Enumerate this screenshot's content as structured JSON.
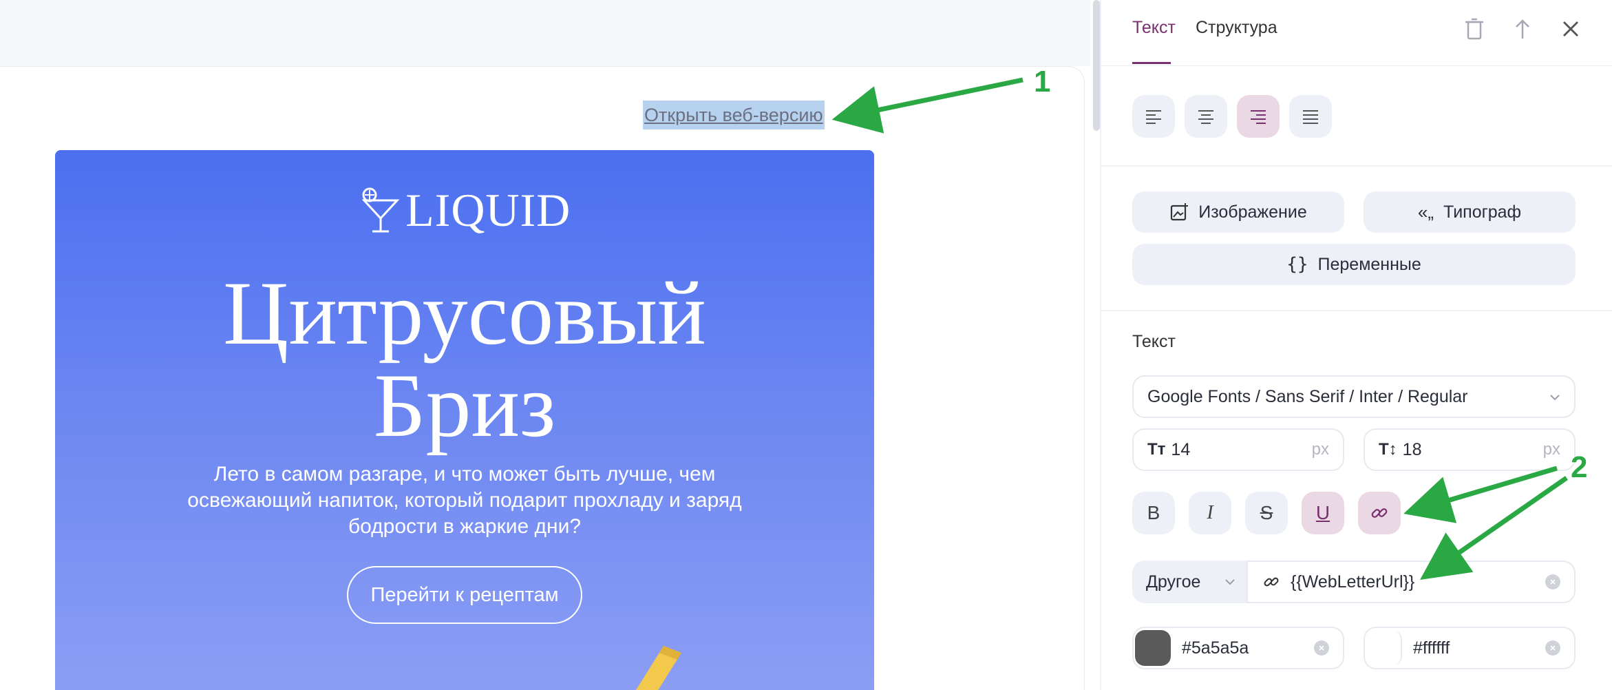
{
  "editor": {
    "web_link": "Открыть веб-версию",
    "logo_text": "LIQUID",
    "title_line1": "Цитрусовый",
    "title_line2": "Бриз",
    "body_text": "Лето в самом разгаре, и что может быть лучше, чем освежающий напиток, который подарит прохладу и заряд бодрости в жаркие дни?",
    "cta_button": "Перейти к рецептам"
  },
  "panel": {
    "tabs": [
      {
        "label": "Текст",
        "active": true
      },
      {
        "label": "Структура",
        "active": false
      }
    ],
    "toolbar_icons": [
      "trash-icon",
      "arrow-up-icon",
      "close-icon"
    ],
    "alignment": [
      "align-left",
      "align-center",
      "align-right",
      "align-justify"
    ],
    "alignment_active": "align-right",
    "buttons": {
      "image": "Изображение",
      "typograph": "Типограф",
      "variables": "Переменные"
    },
    "text_section_label": "Текст",
    "font_family": "Google Fonts / Sans Serif / Inter / Regular",
    "font_size": "14",
    "line_height": "18",
    "unit": "px",
    "format_buttons": [
      {
        "name": "bold",
        "glyph": "B",
        "active": false
      },
      {
        "name": "italic",
        "glyph": "I",
        "active": false
      },
      {
        "name": "strikethrough",
        "glyph": "S",
        "active": false
      },
      {
        "name": "underline",
        "glyph": "U",
        "active": true
      },
      {
        "name": "link",
        "glyph": "",
        "active": true
      }
    ],
    "link_type": "Другое",
    "link_value": "{{WebLetterUrl}}",
    "text_color": "#5a5a5a",
    "bg_color": "#ffffff"
  },
  "annotations": {
    "marker_1": "1",
    "marker_2": "2",
    "arrow_color": "#2aa843"
  },
  "colors": {
    "accent": "#7a2f6e",
    "accent_bg": "#ead9e4",
    "button_bg": "#eef0f7",
    "hero_top": "#4b6ff0",
    "hero_bottom": "#8d9ff4"
  }
}
